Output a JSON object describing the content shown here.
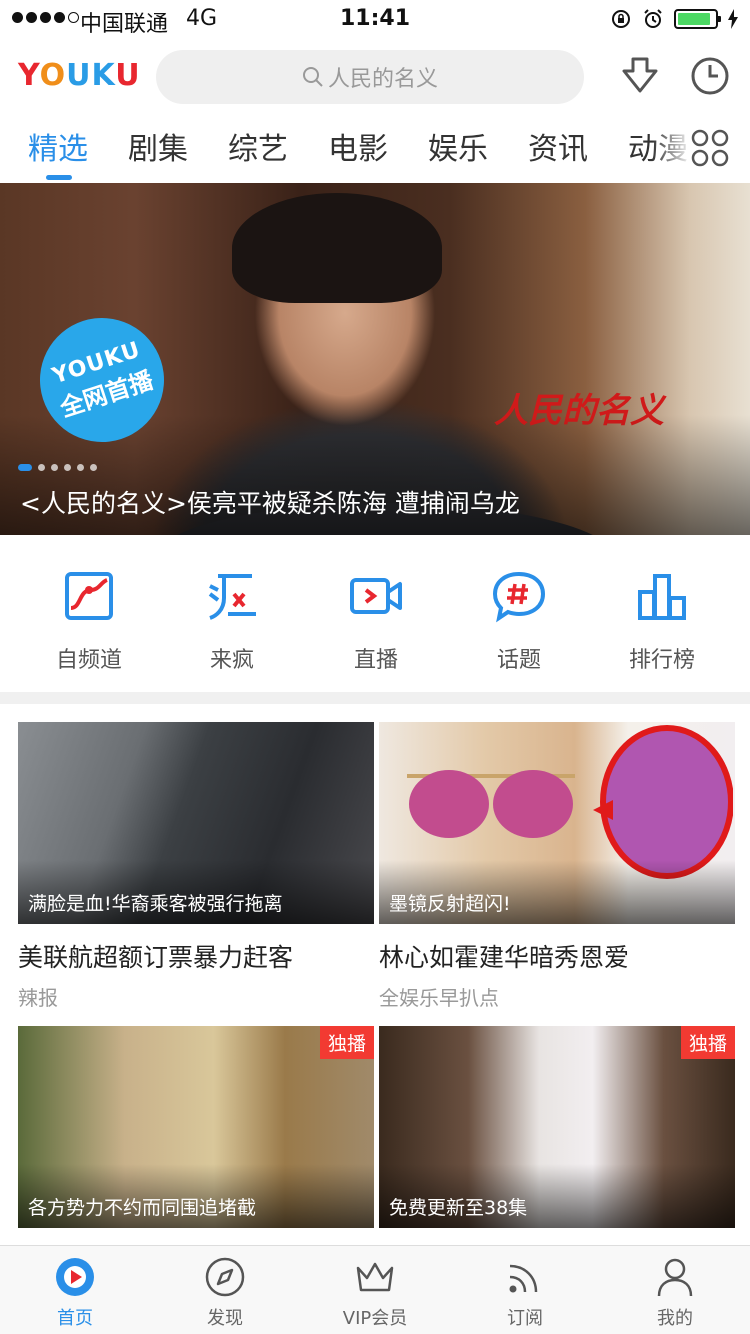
{
  "status_bar": {
    "carrier": "中国联通",
    "network": "4G",
    "time": "11:41",
    "battery_level": 0.9
  },
  "header": {
    "logo": "YOUKU",
    "search_placeholder": "人民的名义"
  },
  "tabs": [
    {
      "label": "精选",
      "active": true
    },
    {
      "label": "剧集"
    },
    {
      "label": "综艺"
    },
    {
      "label": "电影"
    },
    {
      "label": "娱乐"
    },
    {
      "label": "资讯"
    },
    {
      "label": "动漫"
    }
  ],
  "banner": {
    "badge_line1": "YOUKU",
    "badge_line2": "全网首播",
    "title_art": "人民的名义",
    "caption": "<人民的名义>侯亮平被疑杀陈海 遭捕闹乌龙",
    "slide_count": 6,
    "active_slide": 1
  },
  "quick_entries": [
    {
      "label": "自频道",
      "icon": "self-channel-icon"
    },
    {
      "label": "来疯",
      "icon": "laifeng-icon"
    },
    {
      "label": "直播",
      "icon": "live-icon"
    },
    {
      "label": "话题",
      "icon": "topic-icon"
    },
    {
      "label": "排行榜",
      "icon": "ranking-icon"
    }
  ],
  "videos": [
    {
      "overlay": "满脸是血!华裔乘客被强行拖离",
      "title": "美联航超额订票暴力赶客",
      "source": "辣报"
    },
    {
      "overlay": "墨镜反射超闪!",
      "title": "林心如霍建华暗秀恩爱",
      "source": "全娱乐早扒点"
    },
    {
      "overlay": "各方势力不约而同围追堵截",
      "tag": "独播"
    },
    {
      "overlay": "免费更新至38集",
      "tag": "独播"
    }
  ],
  "tabbar": [
    {
      "label": "首页",
      "active": true,
      "icon": "home-icon"
    },
    {
      "label": "发现",
      "icon": "compass-icon"
    },
    {
      "label": "VIP会员",
      "icon": "crown-icon"
    },
    {
      "label": "订阅",
      "icon": "rss-icon"
    },
    {
      "label": "我的",
      "icon": "user-icon"
    }
  ],
  "colors": {
    "accent": "#2a8fe8",
    "tag_red": "#f23a32",
    "battery_green": "#4cd964"
  }
}
